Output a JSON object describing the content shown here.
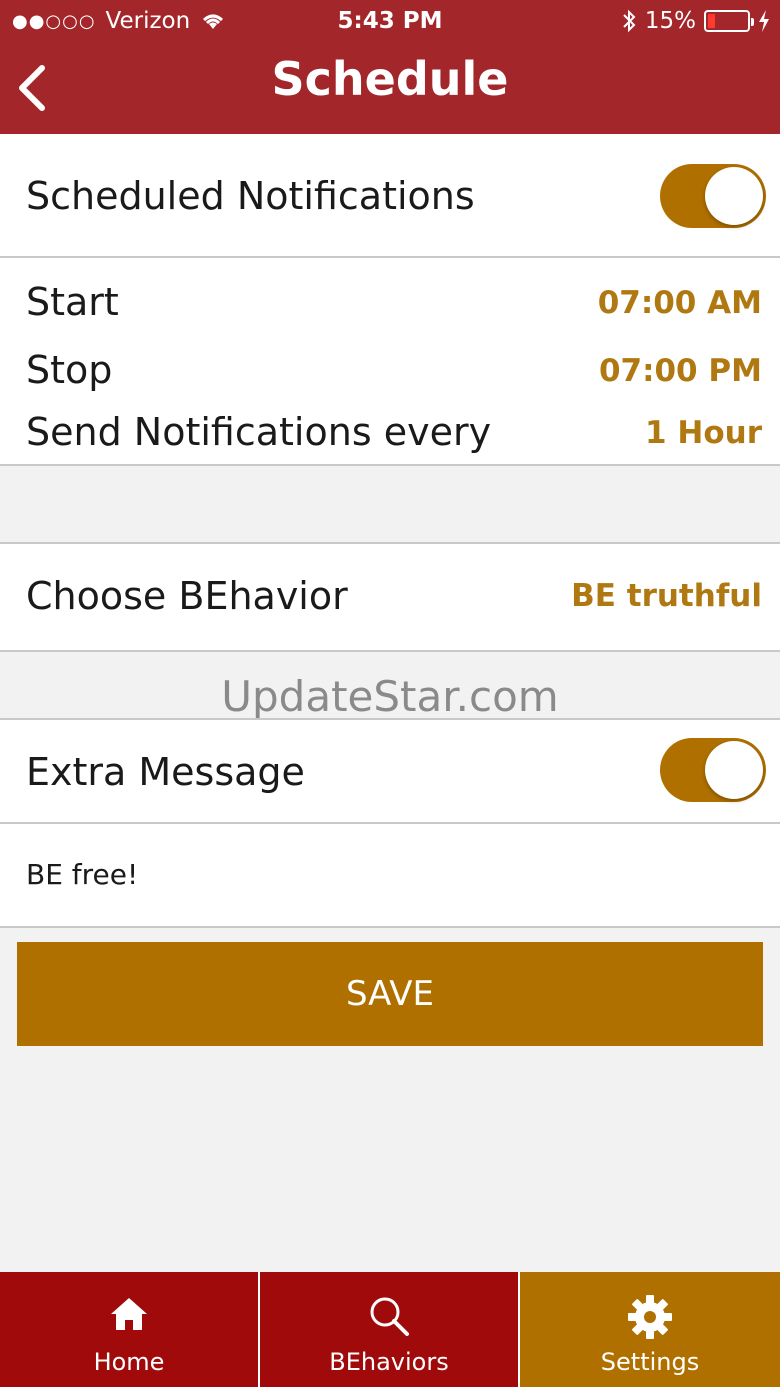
{
  "status_bar": {
    "carrier": "Verizon",
    "time": "5:43 PM",
    "battery": "15%"
  },
  "nav": {
    "title": "Schedule"
  },
  "scheduled_notifications": {
    "label": "Scheduled Notifications",
    "enabled": true
  },
  "schedule": {
    "start_label": "Start",
    "start_value": "07:00 AM",
    "stop_label": "Stop",
    "stop_value": "07:00 PM",
    "interval_label": "Send Notifications every",
    "interval_value": "1 Hour"
  },
  "behavior": {
    "label": "Choose BEhavior",
    "value": "BE truthful"
  },
  "watermark": "UpdateStar.com",
  "extra_message": {
    "label": "Extra Message",
    "enabled": true,
    "text": "BE free!"
  },
  "save_label": "SAVE",
  "tabs": [
    {
      "label": "Home",
      "icon": "home-icon"
    },
    {
      "label": "BEhaviors",
      "icon": "search-icon"
    },
    {
      "label": "Settings",
      "icon": "gear-icon"
    }
  ],
  "colors": {
    "header": "#a3262b",
    "accent": "#b07000",
    "tab_inactive": "#a00a0a"
  }
}
